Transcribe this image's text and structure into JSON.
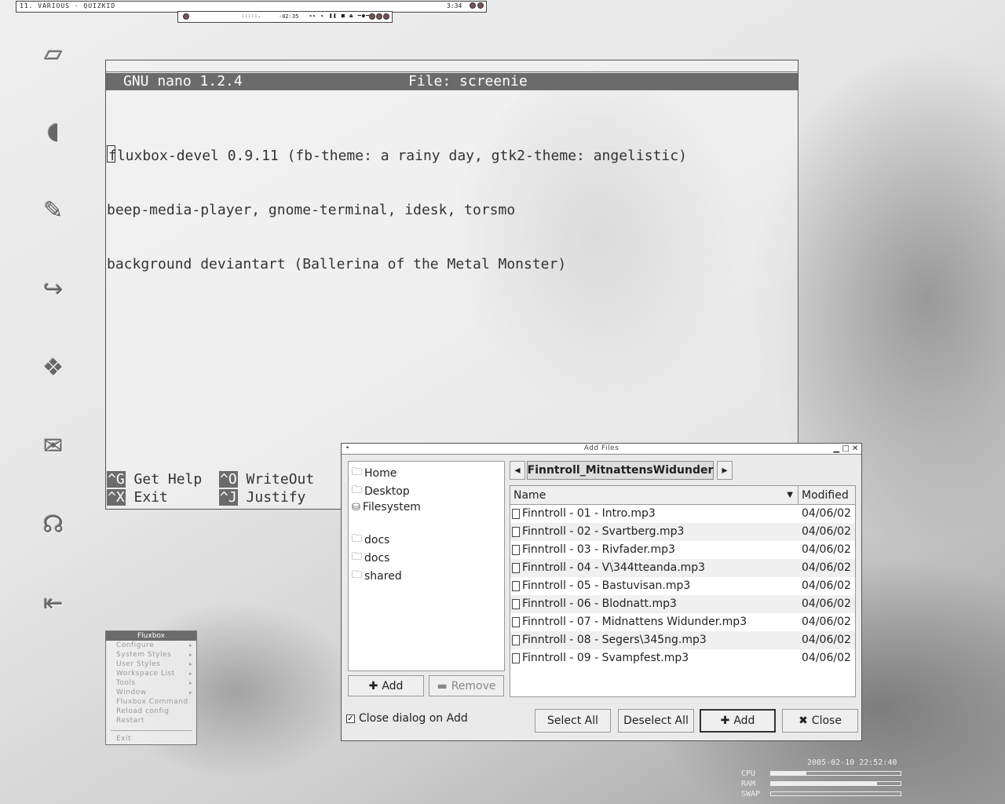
{
  "topbar": {
    "title": "11. VARIOUS - QUIZKID",
    "time": "3:34"
  },
  "player": {
    "visualizer": ":::::.",
    "time": "-02:35",
    "controls": "◂▸ ▸ ❚❚ ■ ⏏ ━●━"
  },
  "nano": {
    "version": "GNU nano 1.2.4",
    "file_label": "File: screenie",
    "lines": [
      "fluxbox-devel 0.9.11 (fb-theme: a rainy day, gtk2-theme: angelistic)",
      "beep-media-player, gnome-terminal, idesk, torsmo",
      "background deviantart (Ballerina of the Metal Monster)"
    ],
    "shortcuts": [
      {
        "key": "^G",
        "label": "Get Help"
      },
      {
        "key": "^O",
        "label": "WriteOut"
      },
      {
        "key": "^X",
        "label": "Exit"
      },
      {
        "key": "^J",
        "label": "Justify"
      }
    ]
  },
  "fluxbox_menu": {
    "title": "Fluxbox",
    "items": [
      {
        "label": "Configure",
        "arrow": "▸"
      },
      {
        "label": "System Styles",
        "arrow": "▸"
      },
      {
        "label": "User Styles",
        "arrow": "▸"
      },
      {
        "label": "Workspace List",
        "arrow": "▸"
      },
      {
        "label": "Tools",
        "arrow": "▸"
      },
      {
        "label": "Window",
        "arrow": "▸"
      },
      {
        "label": "Fluxbox Command",
        "arrow": ""
      },
      {
        "label": "Reload config",
        "arrow": ""
      },
      {
        "label": "Restart",
        "arrow": ""
      }
    ],
    "exit_label": "Exit"
  },
  "dialog": {
    "title": "Add Files",
    "places": [
      "Home",
      "Desktop",
      "Filesystem"
    ],
    "bookmarks": [
      "docs",
      "docs",
      "shared"
    ],
    "add_label": "Add",
    "remove_label": "Remove",
    "path_crumb": "Finntroll_MitnattensWidunder",
    "columns": {
      "name": "Name",
      "modified": "Modified"
    },
    "files": [
      {
        "name": "Finntroll - 01 - Intro.mp3",
        "modified": "04/06/02"
      },
      {
        "name": "Finntroll - 02 - Svartberg.mp3",
        "modified": "04/06/02"
      },
      {
        "name": "Finntroll - 03 - Rivfader.mp3",
        "modified": "04/06/02"
      },
      {
        "name": "Finntroll - 04 - V\\344tteanda.mp3",
        "modified": "04/06/02"
      },
      {
        "name": "Finntroll - 05 - Bastuvisan.mp3",
        "modified": "04/06/02"
      },
      {
        "name": "Finntroll - 06 - Blodnatt.mp3",
        "modified": "04/06/02"
      },
      {
        "name": "Finntroll - 07 - Midnattens Widunder.mp3",
        "modified": "04/06/02"
      },
      {
        "name": "Finntroll - 08 - Segers\\345ng.mp3",
        "modified": "04/06/02"
      },
      {
        "name": "Finntroll - 09 - Svampfest.mp3",
        "modified": "04/06/02"
      }
    ],
    "close_on_add_label": "Close dialog on Add",
    "close_on_add_checked": true,
    "select_all_label": "Select All",
    "deselect_all_label": "Deselect All",
    "footer_add_label": "Add",
    "close_label": "Close"
  },
  "torsmo": {
    "datetime": "2005-02-10 22:52:40",
    "rows": [
      {
        "label": "CPU",
        "fraction": 0.27
      },
      {
        "label": "RAM",
        "fraction": 0.82
      },
      {
        "label": "SWAP",
        "fraction": 0.0
      }
    ]
  }
}
